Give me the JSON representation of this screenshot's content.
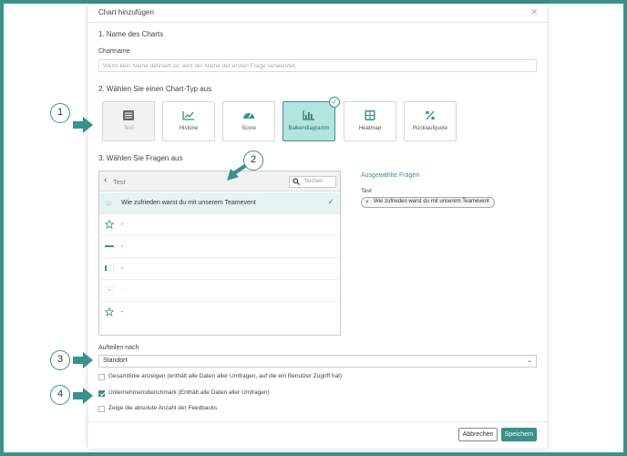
{
  "modal": {
    "title": "Chart hinzufügen",
    "close": "×"
  },
  "section1": {
    "title": "1. Name des Charts",
    "name_label": "Chartname",
    "name_placeholder": "Wenn kein Name definiert ist, wird der Name der ersten Frage verwendet."
  },
  "section2": {
    "title": "2. Wählen Sie einen Chart-Typ aus",
    "types": [
      {
        "label": "Text",
        "icon": "text-icon",
        "state": "disabled"
      },
      {
        "label": "Historie",
        "icon": "history-icon",
        "state": "normal"
      },
      {
        "label": "Score",
        "icon": "gauge-icon",
        "state": "normal"
      },
      {
        "label": "Balkendiagramm",
        "icon": "bar-chart-icon",
        "state": "selected"
      },
      {
        "label": "Heatmap",
        "icon": "heatmap-icon",
        "state": "normal"
      },
      {
        "label": "Rücklaufquote",
        "icon": "percent-icon",
        "state": "normal"
      }
    ],
    "selected_check": "✓"
  },
  "section3": {
    "title": "3. Wählen Sie Fragen aus",
    "panel_title": "Test",
    "search_placeholder": "Suchen",
    "rows": [
      {
        "text": "Wie zufrieden warst du mit unserem Teamevent",
        "icon": "rating-icon",
        "selected": true
      },
      {
        "text": "-",
        "icon": "star-icon",
        "selected": false
      },
      {
        "text": "-",
        "icon": "slider-icon",
        "selected": false
      },
      {
        "text": "-",
        "icon": "choice-icon",
        "selected": false
      },
      {
        "text": "-",
        "icon": "matrix-icon",
        "selected": false
      },
      {
        "text": "-",
        "icon": "star-icon",
        "selected": false
      }
    ],
    "row_check": "✓"
  },
  "selected_questions": {
    "title": "Ausgewählte Fragen",
    "group": "Test",
    "chip_label": "Wie zufrieden warst du mit unserem Teamevent",
    "chip_remove": "×"
  },
  "split": {
    "label": "Aufteilen nach",
    "value": "Standort"
  },
  "options": [
    {
      "label": "Gesamtlinie anzeigen (enthält alle Daten aller Umfragen, auf die ein Benutzer Zugriff hat)",
      "checked": false
    },
    {
      "label": "Unternehmensbenchmark (Enthält alle Daten aller Umfragen)",
      "checked": true
    },
    {
      "label": "Zeige die absolute Anzahl der Feedbacks",
      "checked": false
    }
  ],
  "buttons": {
    "cancel": "Abbrechen",
    "save": "Speichern"
  },
  "callouts": [
    "1",
    "2",
    "3",
    "4"
  ],
  "colors": {
    "accent": "#3a9189",
    "selected_bg": "#b3e4e0",
    "row_selected_bg": "#e5f4f1"
  }
}
